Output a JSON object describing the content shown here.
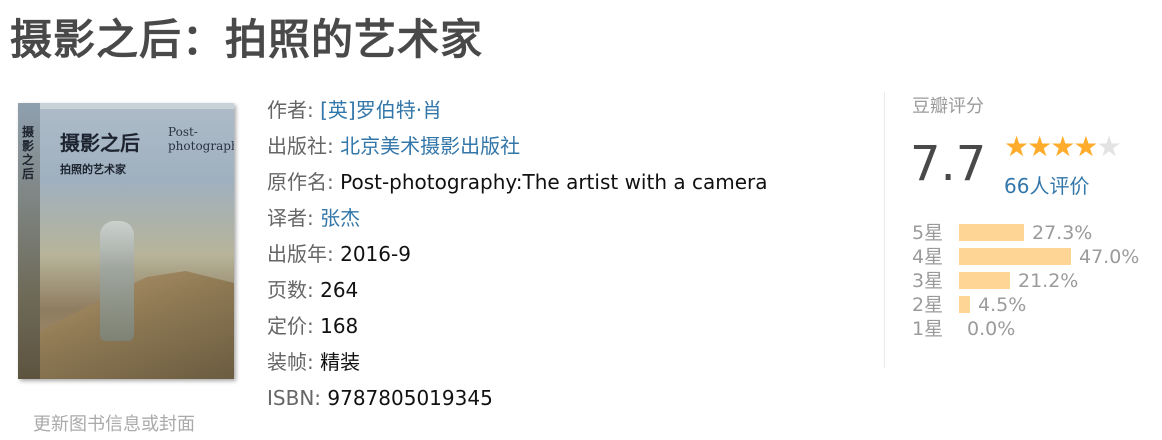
{
  "title": "摄影之后：拍照的艺术家",
  "cover": {
    "cn_title": "摄影之后",
    "cn_subtitle": "拍照的艺术家",
    "en_title": "Post-photography",
    "spine_text": "摄影之后",
    "update_link": "更新图书信息或封面"
  },
  "info": [
    {
      "label": "作者:",
      "value": "[英]罗伯特·肖",
      "link": true
    },
    {
      "label": "出版社:",
      "value": "北京美术摄影出版社",
      "link": true
    },
    {
      "label": "原作名:",
      "value": "Post-photography:The artist with a camera",
      "link": false
    },
    {
      "label": "译者:",
      "value": "张杰",
      "link": true
    },
    {
      "label": "出版年:",
      "value": "2016-9",
      "link": false
    },
    {
      "label": "页数:",
      "value": "264",
      "link": false
    },
    {
      "label": "定价:",
      "value": "168",
      "link": false
    },
    {
      "label": "装帧:",
      "value": "精装",
      "link": false
    },
    {
      "label": "ISBN:",
      "value": "9787805019345",
      "link": false
    }
  ],
  "rating": {
    "heading": "豆瓣评分",
    "score": "7.7",
    "stars_filled": 4,
    "stars_total": 5,
    "count_text": "66人评价",
    "distribution": [
      {
        "label": "5星",
        "percent": 27.3,
        "percent_text": "27.3%"
      },
      {
        "label": "4星",
        "percent": 47.0,
        "percent_text": "47.0%"
      },
      {
        "label": "3星",
        "percent": 21.2,
        "percent_text": "21.2%"
      },
      {
        "label": "2星",
        "percent": 4.5,
        "percent_text": "4.5%"
      },
      {
        "label": "1星",
        "percent": 0.0,
        "percent_text": "0.0%"
      }
    ]
  },
  "colors": {
    "link": "#3377aa",
    "star": "#ffac2d",
    "bar": "#ffd596"
  }
}
